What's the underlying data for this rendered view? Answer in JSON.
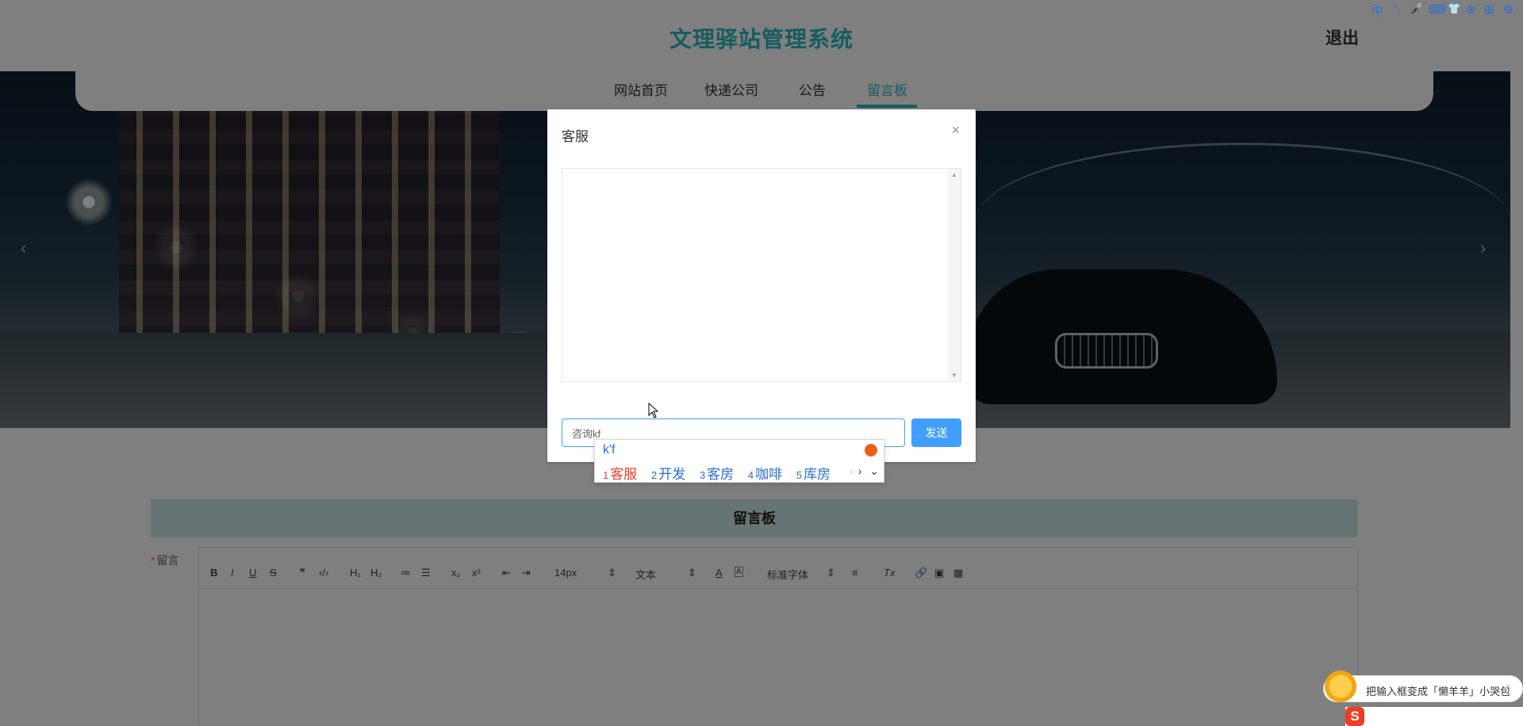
{
  "header": {
    "site_title": "文理驿站管理系统",
    "logout": "退出"
  },
  "nav": {
    "items": [
      {
        "label": "网站首页"
      },
      {
        "label": "快递公司"
      },
      {
        "label": "公告"
      },
      {
        "label": "留言板"
      }
    ],
    "active": "留言板"
  },
  "banner": {
    "prev_arrow": "‹",
    "next_arrow": "›"
  },
  "board": {
    "title": "留言板",
    "field_label": "留言",
    "required_mark": "*",
    "toolbar": {
      "bold": "B",
      "italic": "I",
      "underline": "U",
      "strike": "S",
      "quote": "❞",
      "code": "‹/›",
      "h1": "H₁",
      "h2": "H₂",
      "ordered_list": "≔",
      "bullet_list": "☰",
      "subscript": "x₂",
      "superscript": "x²",
      "outdent": "⇤",
      "indent": "⇥",
      "size_select": "14px",
      "header_select": "文本",
      "font_color": "A",
      "bg_color": "A",
      "font_select": "标准字体",
      "align": "≡",
      "clean": "Tx",
      "link": "🔗",
      "image": "▣",
      "video": "▦",
      "select_arrow": "⇕"
    }
  },
  "dialog": {
    "title": "客服",
    "close": "×",
    "input_value": "咨询kf",
    "send_label": "发送",
    "scroll_up": "▲",
    "scroll_down": "▼"
  },
  "ime": {
    "pinyin": "k'f",
    "candidates": [
      {
        "num": "1",
        "text": "客服"
      },
      {
        "num": "2",
        "text": "开发"
      },
      {
        "num": "3",
        "text": "客房"
      },
      {
        "num": "4",
        "text": "咖啡"
      },
      {
        "num": "5",
        "text": "库房"
      }
    ],
    "prev": "‹",
    "next": "›",
    "expand": "⌄"
  },
  "tray": {
    "tip_text": "把输入框变成「懒羊羊」小哭包",
    "tip_close": "×",
    "logo": "S",
    "status": [
      "中",
      "°,",
      "🎤",
      "⌨",
      "👕",
      "⊕",
      "⊞",
      "⚙"
    ]
  },
  "colors": {
    "accent": "#2cb8bd",
    "primary": "#409eff",
    "ime_blue": "#2a6fd6",
    "ime_red": "#e8402a"
  }
}
